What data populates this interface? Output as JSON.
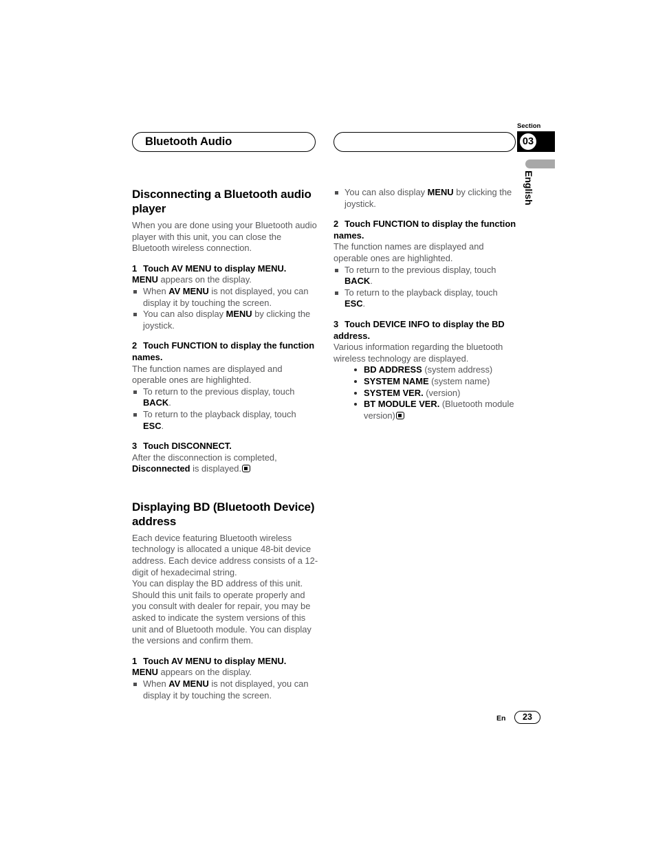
{
  "header": {
    "left_pill_label": "Bluetooth Audio",
    "right_pill_label": "",
    "section_word": "Section",
    "section_number": "03",
    "language_tab": "English"
  },
  "footer": {
    "lang_code": "En",
    "page_number": "23"
  },
  "left_column": {
    "heading": "Disconnecting a Bluetooth audio player",
    "intro": "When you are done using your Bluetooth audio player with this unit, you can close the Bluetooth wireless connection.",
    "step1": {
      "num": "1",
      "title": "Touch AV MENU to display MENU.",
      "body_bold": "MENU",
      "body_rest": " appears on the display.",
      "notes": [
        {
          "pre": "When ",
          "kw": "AV MENU",
          "post": " is not displayed, you can display it by touching the screen."
        },
        {
          "pre": "You can also display ",
          "kw": "MENU",
          "post": " by clicking the joystick."
        }
      ]
    },
    "step2": {
      "num": "2",
      "title": "Touch FUNCTION to display the function names.",
      "body": "The function names are displayed and operable ones are highlighted.",
      "notes": [
        {
          "pre": "To return to the previous display, touch ",
          "kw": "BACK",
          "post": "."
        },
        {
          "pre": "To return to the playback display, touch ",
          "kw": "ESC",
          "post": "."
        }
      ]
    },
    "step3": {
      "num": "3",
      "title": "Touch DISCONNECT.",
      "body_pre": "After the disconnection is completed, ",
      "body_kw": "Disconnected",
      "body_post": " is displayed."
    },
    "heading2": "Displaying BD (Bluetooth Device) address",
    "intro2_p1": "Each device featuring Bluetooth wireless technology is allocated a unique 48-bit device address. Each device address consists of a 12-digit of hexadecimal string.",
    "intro2_p2": "You can display the BD address of this unit. Should this unit fails to operate properly and you consult with dealer for repair, you may be asked to indicate the system versions of this unit and of Bluetooth module. You can display the versions and confirm them.",
    "step1b": {
      "num": "1",
      "title": "Touch AV MENU to display MENU.",
      "body_bold": "MENU",
      "body_rest": " appears on the display.",
      "note": {
        "pre": "When ",
        "kw": "AV MENU",
        "post": " is not displayed, you can display it by touching the screen."
      }
    }
  },
  "right_column": {
    "note_top": {
      "pre": "You can also display ",
      "kw": "MENU",
      "post": " by clicking the joystick."
    },
    "step2": {
      "num": "2",
      "title": "Touch FUNCTION to display the function names.",
      "body": "The function names are displayed and operable ones are highlighted.",
      "notes": [
        {
          "pre": "To return to the previous display, touch ",
          "kw": "BACK",
          "post": "."
        },
        {
          "pre": "To return to the playback display, touch ",
          "kw": "ESC",
          "post": "."
        }
      ]
    },
    "step3": {
      "num": "3",
      "title": "Touch DEVICE INFO to display the BD address.",
      "body": "Various information regarding the bluetooth wireless technology are displayed.",
      "items": [
        {
          "kw": "BD ADDRESS",
          "rest": " (system address)"
        },
        {
          "kw": "SYSTEM NAME",
          "rest": " (system name)"
        },
        {
          "kw": "SYSTEM VER.",
          "rest": " (version)"
        },
        {
          "kw": "BT MODULE VER.",
          "rest": " (Bluetooth module version)"
        }
      ]
    }
  }
}
